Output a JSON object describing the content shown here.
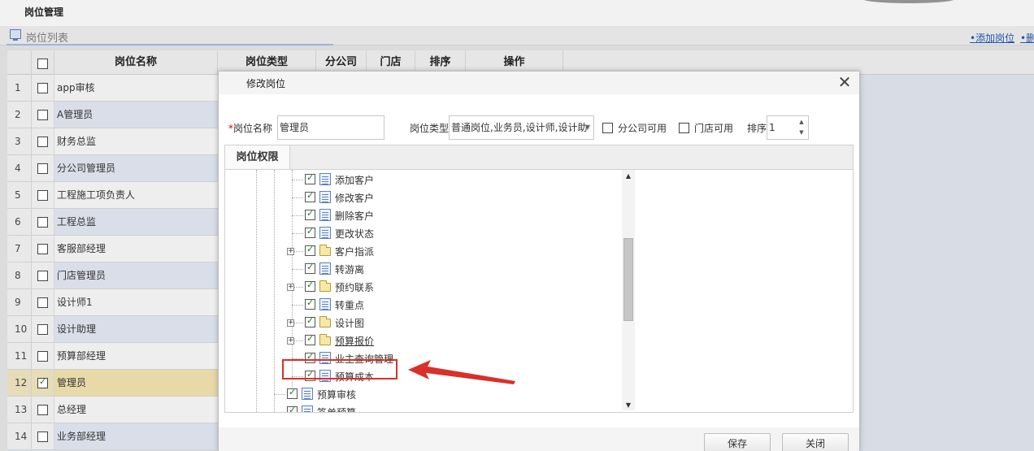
{
  "page": {
    "title": "岗位管理"
  },
  "panel": {
    "title": "岗位列表",
    "links": [
      "•添加岗位",
      "•删"
    ]
  },
  "grid": {
    "headers": [
      "岗位名称",
      "岗位类型",
      "分公司",
      "门店",
      "排序",
      "操作"
    ],
    "rows": [
      {
        "num": "1",
        "name": "app审核",
        "checked": false
      },
      {
        "num": "2",
        "name": "A管理员",
        "checked": false
      },
      {
        "num": "3",
        "name": "财务总监",
        "checked": false
      },
      {
        "num": "4",
        "name": "分公司管理员",
        "checked": false
      },
      {
        "num": "5",
        "name": "工程施工项负责人",
        "checked": false
      },
      {
        "num": "6",
        "name": "工程总监",
        "checked": false
      },
      {
        "num": "7",
        "name": "客服部经理",
        "checked": false
      },
      {
        "num": "8",
        "name": "门店管理员",
        "checked": false
      },
      {
        "num": "9",
        "name": "设计师1",
        "checked": false
      },
      {
        "num": "10",
        "name": "设计助理",
        "checked": false
      },
      {
        "num": "11",
        "name": "预算部经理",
        "checked": false
      },
      {
        "num": "12",
        "name": "管理员",
        "checked": true
      },
      {
        "num": "13",
        "name": "总经理",
        "checked": false
      },
      {
        "num": "14",
        "name": "业务部经理",
        "checked": false
      }
    ]
  },
  "dialog": {
    "title": "修改岗位",
    "close_icon": "✕",
    "form": {
      "name_required_mark": "*",
      "name_label": "岗位名称",
      "name_value": "管理员",
      "type_label": "岗位类型",
      "type_value": "普通岗位,业务员,设计师,设计助",
      "branch_label": "分公司可用",
      "store_label": "门店可用",
      "sort_label": "排序",
      "sort_value": "1"
    },
    "tab_label": "岗位权限",
    "tree": [
      {
        "label": "添加客户",
        "icon": "page",
        "level": 2,
        "expander": false,
        "underline": false
      },
      {
        "label": "修改客户",
        "icon": "page",
        "level": 2,
        "expander": false,
        "underline": false
      },
      {
        "label": "删除客户",
        "icon": "page",
        "level": 2,
        "expander": false,
        "underline": false
      },
      {
        "label": "更改状态",
        "icon": "page",
        "level": 2,
        "expander": false,
        "underline": false
      },
      {
        "label": "客户指派",
        "icon": "folder",
        "level": 2,
        "expander": true,
        "underline": false
      },
      {
        "label": "转游离",
        "icon": "page",
        "level": 2,
        "expander": false,
        "underline": false
      },
      {
        "label": "预约联系",
        "icon": "folder",
        "level": 2,
        "expander": true,
        "underline": false
      },
      {
        "label": "转重点",
        "icon": "page",
        "level": 2,
        "expander": false,
        "underline": false
      },
      {
        "label": "设计图",
        "icon": "folder",
        "level": 2,
        "expander": true,
        "underline": false
      },
      {
        "label": "预算报价",
        "icon": "folder",
        "level": 2,
        "expander": true,
        "underline": true
      },
      {
        "label": "业主查询管理",
        "icon": "page",
        "level": 2,
        "expander": false,
        "underline": false
      },
      {
        "label": "预算成本",
        "icon": "page",
        "level": 2,
        "expander": false,
        "underline": false
      },
      {
        "label": "预算审核",
        "icon": "page",
        "level": 1,
        "expander": false,
        "underline": false
      },
      {
        "label": "签单预算",
        "icon": "page",
        "level": 1,
        "expander": false,
        "underline": false
      }
    ],
    "buttons": {
      "save": "保存",
      "close": "关闭"
    }
  },
  "colors": {
    "annotation_red": "#d9302a",
    "link_blue": "#2255aa",
    "selected_row": "#e8d9a8"
  }
}
